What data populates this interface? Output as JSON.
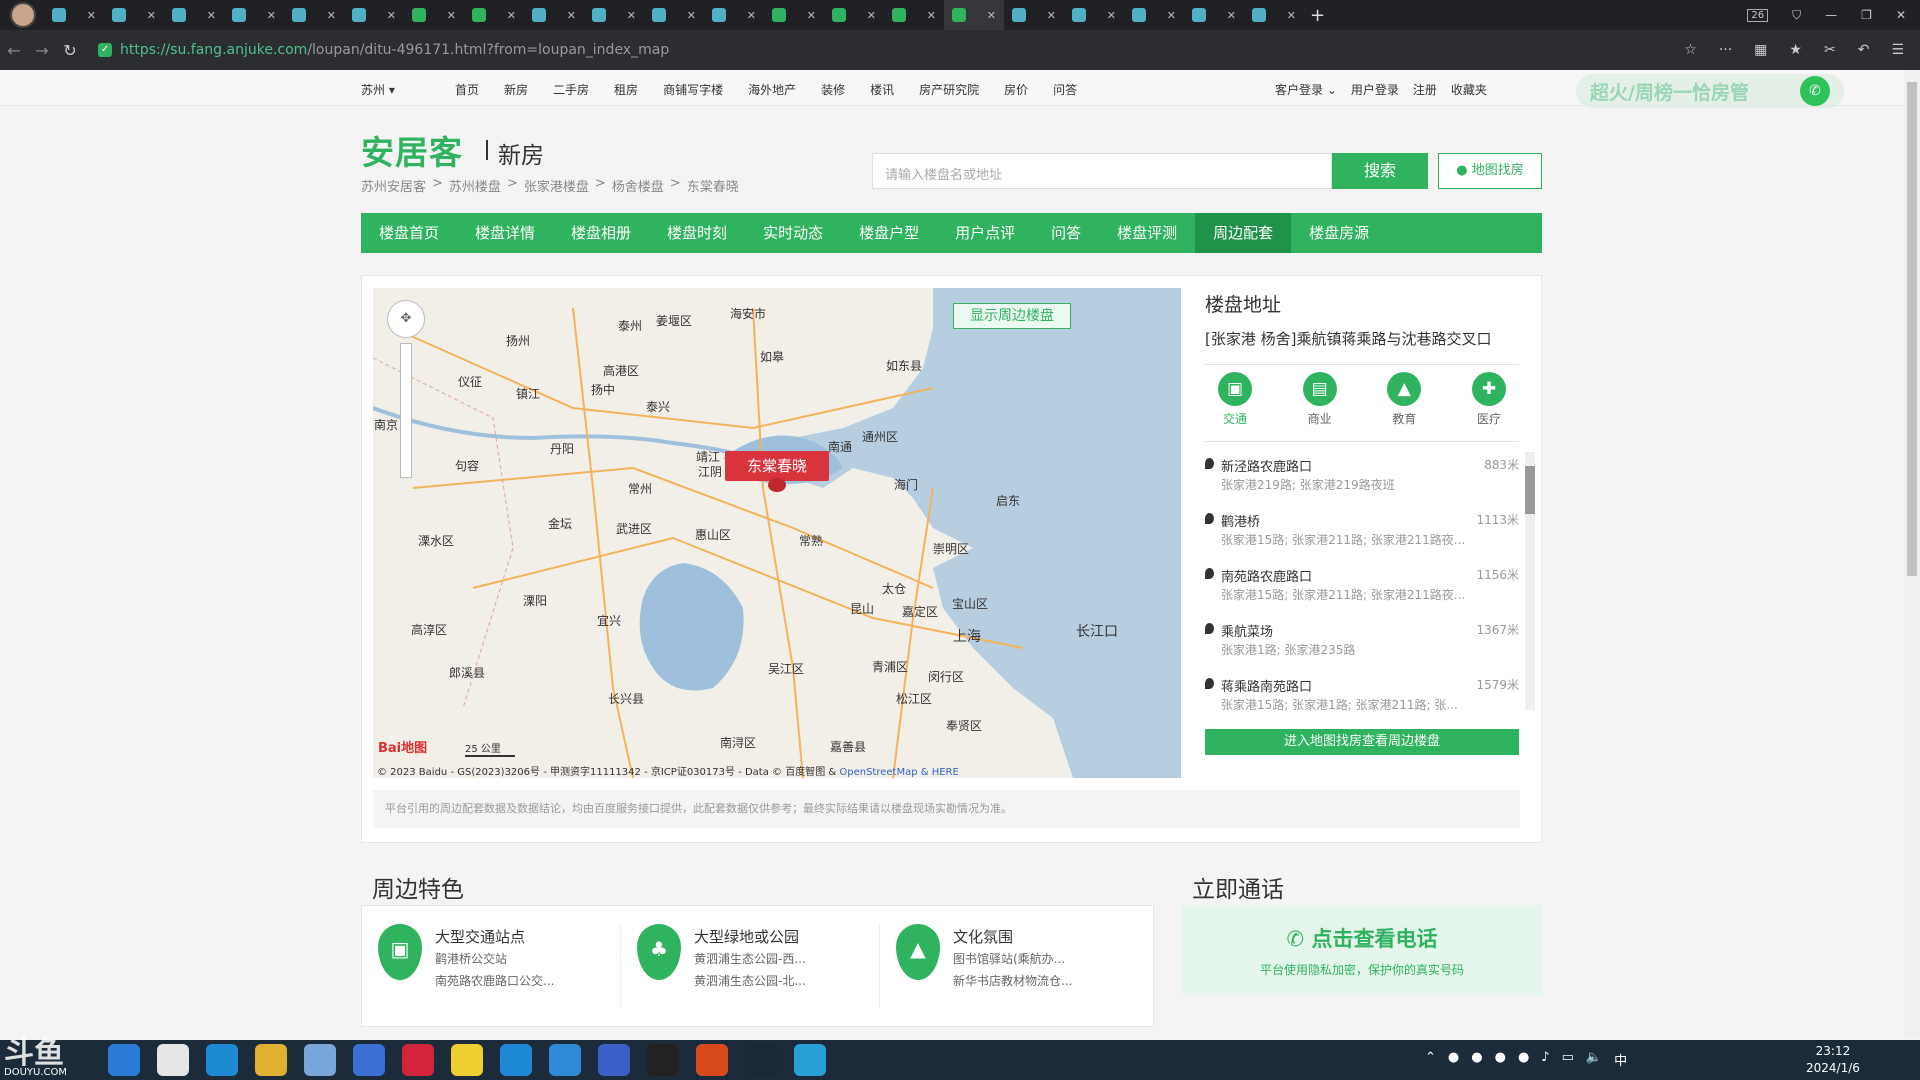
{
  "browser": {
    "tab_count_badge": "26",
    "url_domain": "https://su.fang.anjuke.com",
    "url_path": "/loupan/ditu-496171.html?from=loupan_index_map"
  },
  "topnav": {
    "city": "苏州 ▾",
    "links": [
      "首页",
      "新房",
      "二手房",
      "租房",
      "商铺写字楼",
      "海外地产",
      "装修",
      "楼讯",
      "房产研究院",
      "房价",
      "问答"
    ],
    "right": [
      "客户登录 ⌄",
      "用户登录",
      "注册",
      "收藏夹"
    ],
    "promo": "超火/周榜一恰房管"
  },
  "header": {
    "logo": "安居客",
    "logo_sub": "新房",
    "breadcrumb": [
      "苏州安居客",
      ">",
      "苏州楼盘",
      ">",
      "张家港楼盘",
      ">",
      "杨舍楼盘",
      ">",
      "东棠春晓"
    ],
    "search_placeholder": "请输入楼盘名或地址",
    "search_button": "搜索",
    "map_find": "地图找房"
  },
  "greennav": [
    "楼盘首页",
    "楼盘详情",
    "楼盘相册",
    "楼盘时刻",
    "实时动态",
    "楼盘户型",
    "用户点评",
    "问答",
    "楼盘评测",
    "周边配套",
    "楼盘房源"
  ],
  "greennav_active": "周边配套",
  "map": {
    "show_nearby": "显示周边楼盘",
    "marker": "东棠春晓",
    "scale": "25 公里",
    "baidu": "Bai地图",
    "copyright": "© 2023 Baidu - GS(2023)3206号 - 甲测资字11111342 - 京ICP证030173号 - Data © 百度智图 &",
    "copyright_links": "OpenStreetMap & HERE",
    "labels": [
      "泰州",
      "姜堰区",
      "海安市",
      "扬州",
      "如皋",
      "如东县",
      "高港区",
      "仪征",
      "扬中",
      "泰兴",
      "镇江",
      "丹阳",
      "靖江",
      "江阴",
      "南通",
      "通州区",
      "南京",
      "句容",
      "常州",
      "海门",
      "启东",
      "金坛",
      "武进区",
      "惠山区",
      "常熟",
      "崇明区",
      "溧水区",
      "太仓",
      "宝山区",
      "溧阳",
      "宜兴",
      "昆山",
      "嘉定区",
      "长江口",
      "上海",
      "高淳区",
      "郎溪县",
      "吴江区",
      "青浦区",
      "闵行区",
      "长兴县",
      "松江区",
      "南浔区",
      "嘉善县",
      "奉贤区"
    ],
    "notice": "平台引用的周边配套数据及数据结论，均由百度服务接口提供，此配套数据仅供参考；最终实际结果请以楼盘现场实勘情况为准。"
  },
  "address": {
    "title": "楼盘地址",
    "text": "[张家港 杨舍]乘航镇蒋乘路与沈巷路交叉口",
    "categories": [
      {
        "label": "交通",
        "icon": "bus-icon"
      },
      {
        "label": "商业",
        "icon": "shop-basket-icon"
      },
      {
        "label": "教育",
        "icon": "graduation-cap-icon"
      },
      {
        "label": "医疗",
        "icon": "medical-icon"
      }
    ],
    "pois": [
      {
        "name": "新泾路农鹿路口",
        "dist": "883米",
        "sub": "张家港219路; 张家港219路夜班"
      },
      {
        "name": "鹳港桥",
        "dist": "1113米",
        "sub": "张家港15路; 张家港211路; 张家港211路夜..."
      },
      {
        "name": "南苑路农鹿路口",
        "dist": "1156米",
        "sub": "张家港15路; 张家港211路; 张家港211路夜..."
      },
      {
        "name": "乘航菜场",
        "dist": "1367米",
        "sub": "张家港1路; 张家港235路"
      },
      {
        "name": "蒋乘路南苑路口",
        "dist": "1579米",
        "sub": "张家港15路; 张家港1路; 张家港211路; 张..."
      }
    ],
    "enter_map": "进入地图找房查看周边楼盘"
  },
  "nearby": {
    "title": "周边特色",
    "features": [
      {
        "title": "大型交通站点",
        "l1": "鹳港桥公交站",
        "l2": "南苑路农鹿路口公交...",
        "icon": "bus-icon"
      },
      {
        "title": "大型绿地或公园",
        "l1": "黄泗浦生态公园-西...",
        "l2": "黄泗浦生态公园-北...",
        "icon": "tree-icon"
      },
      {
        "title": "文化氛围",
        "l1": "图书馆驿站(乘航办...",
        "l2": "新华书店教材物流仓...",
        "icon": "graduation-cap-icon"
      }
    ]
  },
  "call": {
    "title": "立即通话",
    "main": "点击查看电话",
    "sub": "平台使用隐私加密，保护你的真实号码"
  },
  "taskbar": {
    "watermark": "斗鱼",
    "watermark_sub": "DOUYU.COM",
    "time": "23:12",
    "date": "2024/1/6",
    "ime": "中"
  },
  "colors": {
    "brand": "#2fb35f",
    "marker": "#d9343b"
  }
}
